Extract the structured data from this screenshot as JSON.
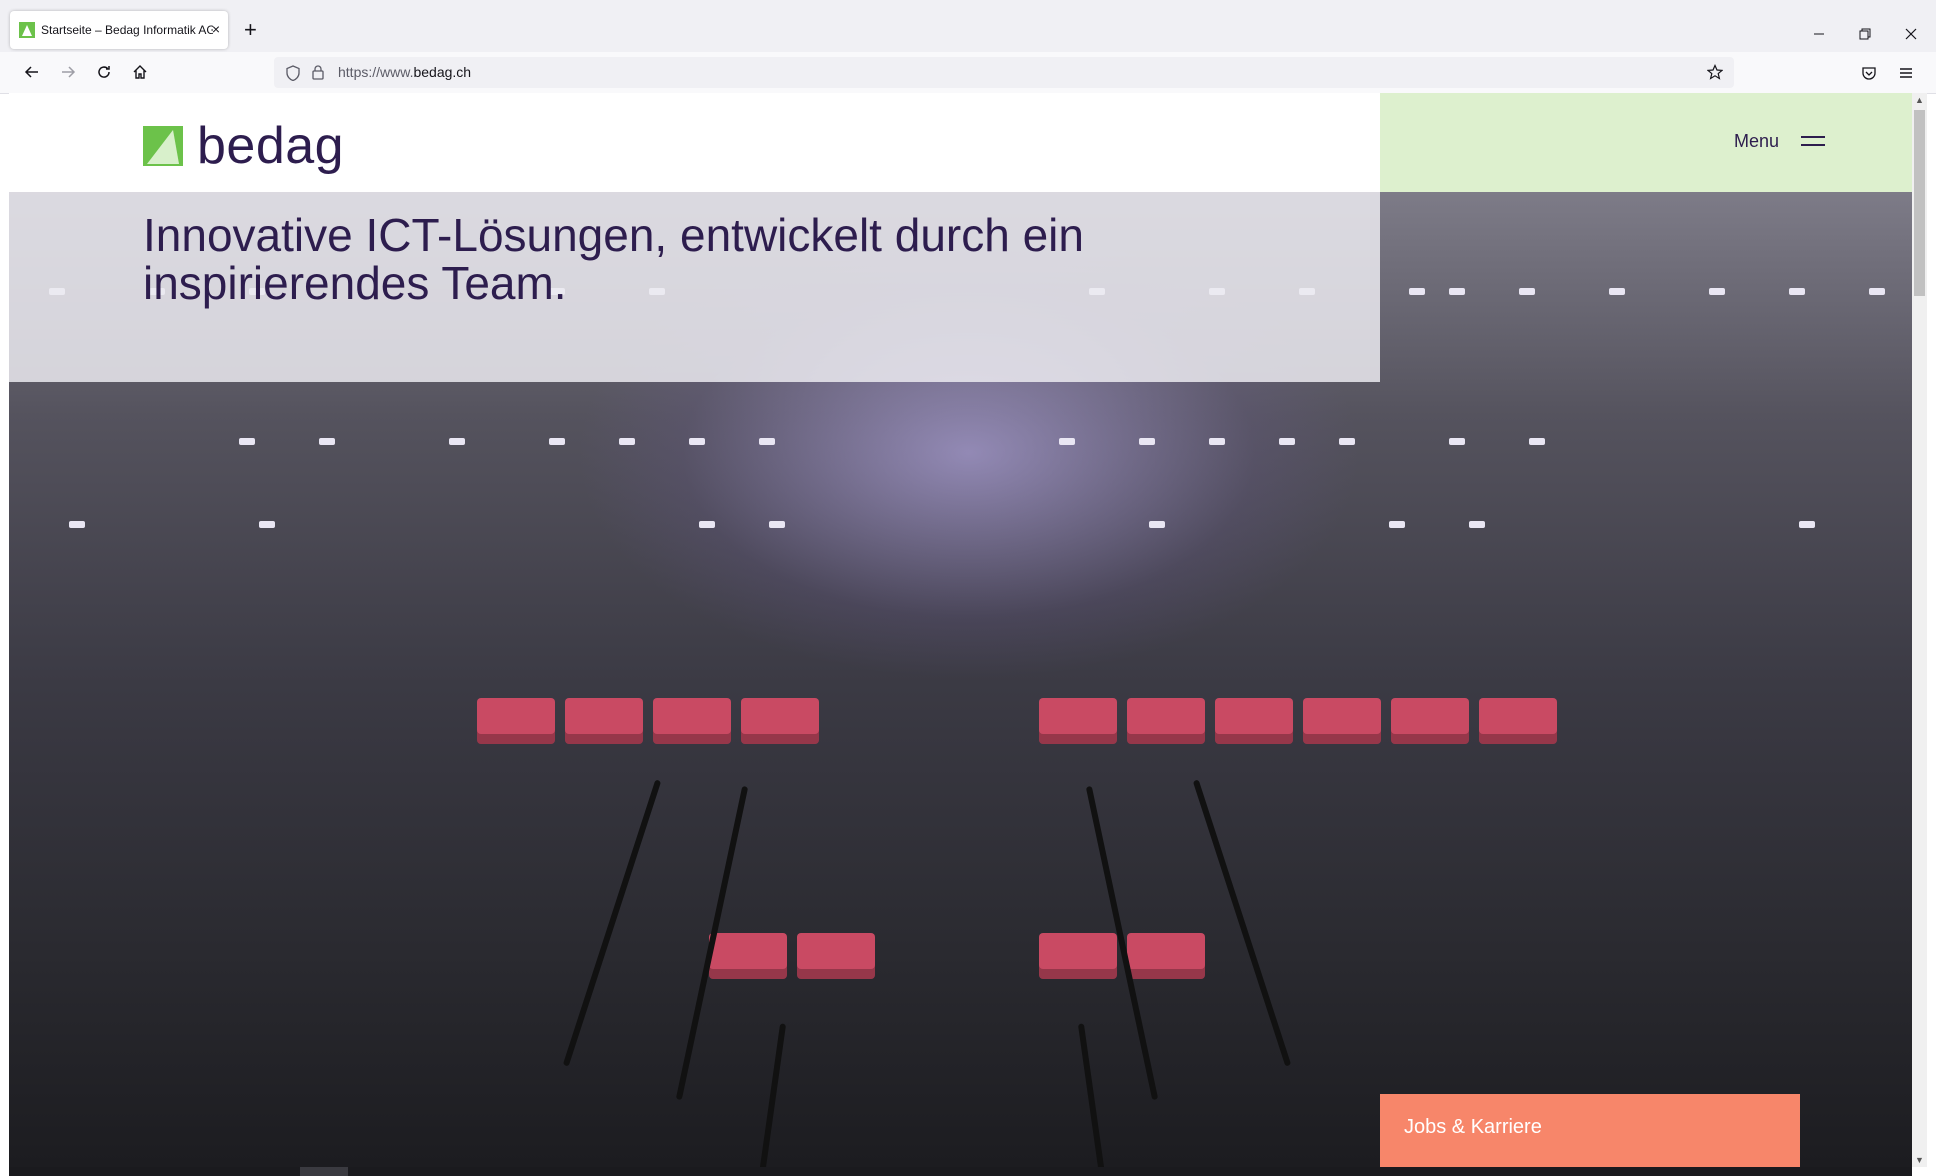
{
  "browser": {
    "tab_title": "Startseite – Bedag Informatik AG",
    "tab_close": "×",
    "new_tab": "+",
    "url_prefix": "https://www.",
    "url_host": "bedag.ch"
  },
  "header": {
    "logo_text": "bedag",
    "menu_label": "Menu"
  },
  "hero": {
    "title": "Innovative ICT-Lösungen, entwickelt durch ein inspirierendes Team."
  },
  "cta": {
    "jobs_label": "Jobs & Karriere"
  },
  "colors": {
    "brand_purple": "#2d1d4e",
    "brand_green": "#6cc24a",
    "header_green": "#ddf0ce",
    "cta_orange": "#f7866a"
  }
}
